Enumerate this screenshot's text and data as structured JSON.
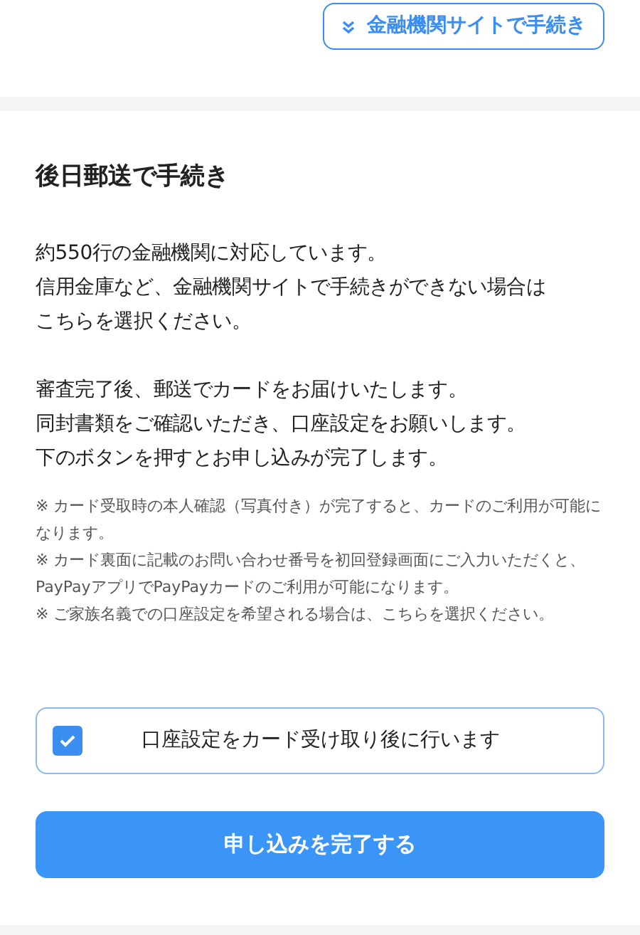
{
  "top_link": {
    "label": "金融機関サイトで手続き"
  },
  "section": {
    "title": "後日郵送で手続き",
    "paragraphs": [
      {
        "lines": [
          "約550行の金融機関に対応しています。",
          "信用金庫など、金融機関サイトで手続きができない場合は",
          "こちらを選択ください。"
        ]
      },
      {
        "lines": [
          "審査完了後、郵送でカードをお届けいたします。",
          "同封書類をご確認いただき、口座設定をお願いします。",
          "下のボタンを押すとお申し込みが完了します。"
        ]
      }
    ],
    "notes": [
      "※ カード受取時の本人確認（写真付き）が完了すると、カードのご利用が可能になります。",
      "※ カード裏面に記載のお問い合わせ番号を初回登録画面にご入力いただくと、PayPayアプリでPayPayカードのご利用が可能になります。",
      "※ ご家族名義での口座設定を希望される場合は、こちらを選択ください。"
    ],
    "checkbox": {
      "label": "口座設定をカード受け取り後に行います",
      "checked": true
    },
    "submit": {
      "label": "申し込みを完了する"
    }
  }
}
